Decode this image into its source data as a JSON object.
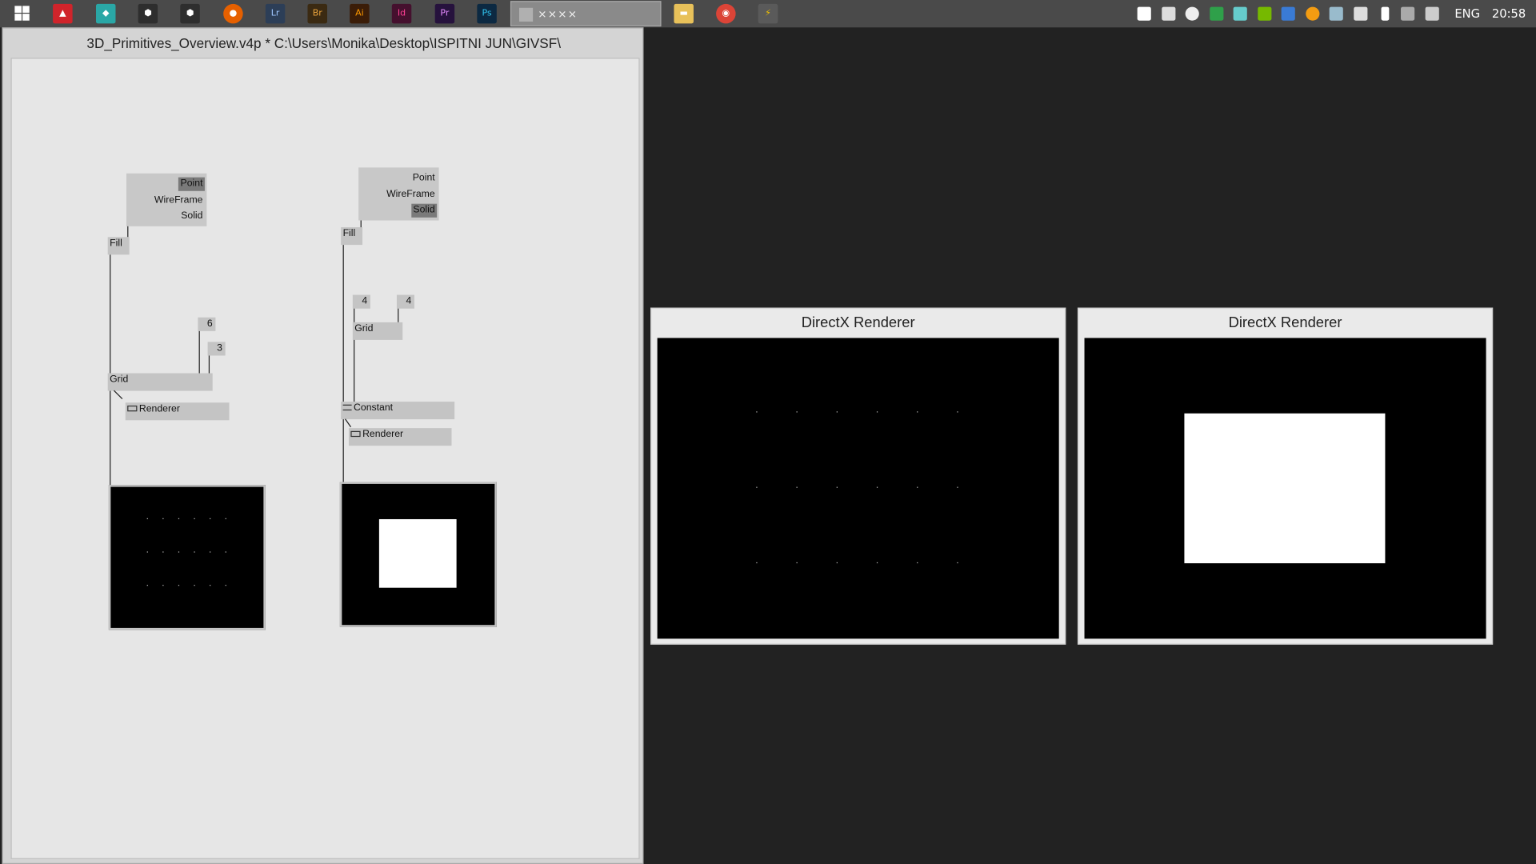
{
  "taskbar": {
    "apps": [
      {
        "name": "start",
        "label": ""
      },
      {
        "name": "acrobat",
        "label": "",
        "color": "#d0242b"
      },
      {
        "name": "maya",
        "label": "",
        "color": "#2aa7a6"
      },
      {
        "name": "unity",
        "label": "",
        "color": "#333"
      },
      {
        "name": "unity2",
        "label": "",
        "color": "#333"
      },
      {
        "name": "firefox",
        "label": "",
        "color": "#e66000"
      },
      {
        "name": "lightroom",
        "label": "Lr",
        "color": "#2c3e57"
      },
      {
        "name": "bridge",
        "label": "Br",
        "color": "#3b2a12"
      },
      {
        "name": "illustrator",
        "label": "Ai",
        "color": "#3b1d08"
      },
      {
        "name": "indesign",
        "label": "Id",
        "color": "#45102e"
      },
      {
        "name": "premiere",
        "label": "Pr",
        "color": "#26123d"
      },
      {
        "name": "photoshop",
        "label": "Ps",
        "color": "#0c2942"
      }
    ],
    "active_window_label": "××××",
    "pinned": [
      {
        "name": "file-explorer"
      },
      {
        "name": "chrome"
      },
      {
        "name": "vvvv"
      }
    ],
    "tray": {
      "language": "ENG",
      "time": "20:58"
    }
  },
  "patch": {
    "title": "3D_Primitives_Overview.v4p *  C:\\Users\\Monika\\Desktop\\ISPITNI JUN\\GIVSF\\",
    "left": {
      "enum_items": [
        "Point",
        "WireFrame",
        "Solid"
      ],
      "enum_selected": "Point",
      "fill_label": "Fill",
      "num_a": "6",
      "num_b": "3",
      "grid_label": "Grid",
      "renderer_label": "Renderer"
    },
    "right": {
      "enum_items": [
        "Point",
        "WireFrame",
        "Solid"
      ],
      "enum_selected": "Solid",
      "fill_label": "Fill",
      "num_a": "4",
      "num_b": "4",
      "grid_label": "Grid",
      "constant_label": "Constant",
      "renderer_label": "Renderer"
    }
  },
  "renderers": [
    {
      "title": "DirectX Renderer",
      "mode": "Point"
    },
    {
      "title": "DirectX Renderer",
      "mode": "Solid"
    }
  ]
}
